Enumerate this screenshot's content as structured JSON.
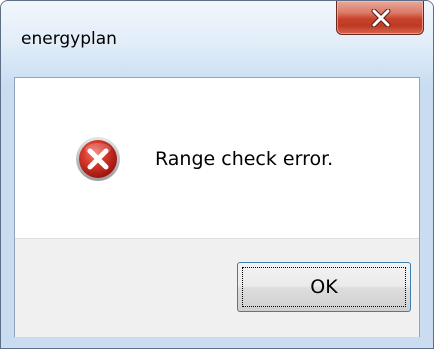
{
  "window": {
    "title": "energyplan"
  },
  "title_bar": {
    "close_icon": "close-icon"
  },
  "dialog": {
    "icon": "error-icon",
    "message": "Range check error.",
    "ok_label": "OK"
  },
  "colors": {
    "close_button": "#c7402a",
    "error_icon": "#c41f1f",
    "button_border": "#3c7fb1",
    "button_area_bg": "#f0f0f0"
  }
}
